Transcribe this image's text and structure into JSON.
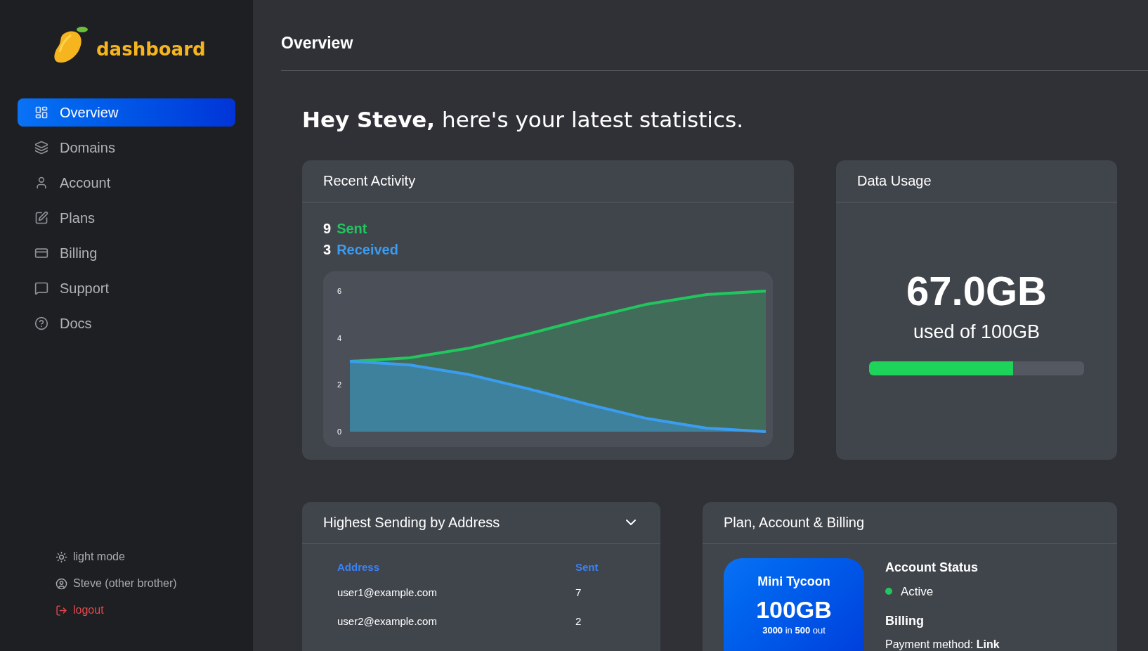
{
  "sidebar": {
    "logo_text": "dashboard",
    "items": [
      {
        "label": "Overview",
        "selected": true
      },
      {
        "label": "Domains",
        "selected": false
      },
      {
        "label": "Account",
        "selected": false
      },
      {
        "label": "Plans",
        "selected": false
      },
      {
        "label": "Billing",
        "selected": false
      },
      {
        "label": "Support",
        "selected": false
      },
      {
        "label": "Docs",
        "selected": false
      }
    ],
    "footer": [
      {
        "label": "light mode",
        "kind": "theme"
      },
      {
        "label": "Steve (other brother)",
        "kind": "user"
      },
      {
        "label": "logout",
        "kind": "logout"
      }
    ]
  },
  "header": {
    "title": "Overview"
  },
  "greeting": "**Hey Steve,** here's your latest statistics.",
  "recent_activity": {
    "title": "Recent Activity",
    "counts": [
      "9",
      "3"
    ],
    "chart_data": {
      "type": "area",
      "categories": [
        null,
        null,
        null,
        null,
        null,
        null,
        null,
        null
      ],
      "ylim": [
        0,
        6.84
      ],
      "yticks": [
        {
          "value": 0,
          "label": "0"
        },
        {
          "value": 2,
          "label": "2"
        },
        {
          "value": 4,
          "label": "4"
        },
        {
          "value": 6,
          "label": "6"
        }
      ],
      "series": [
        {
          "name": "Sent",
          "color": "#22c55e",
          "values": [
            3,
            3.15,
            3.56,
            4.17,
            4.83,
            5.44,
            5.85,
            6
          ]
        },
        {
          "name": "Received",
          "color": "#3b9cf0",
          "values": [
            3,
            2.85,
            2.44,
            1.83,
            1.17,
            0.56,
            0.15,
            0
          ]
        }
      ]
    }
  },
  "data_usage": {
    "title": "Data Usage",
    "amount": "67.0GB",
    "caption": "used of 100GB",
    "level": 0.67
  },
  "highest_sending": {
    "title": "Highest Sending by Address",
    "columns": [
      "Address",
      "Sent"
    ],
    "rows": [
      [
        "user1@example.com",
        "7"
      ],
      [
        "user2@example.com",
        "2"
      ]
    ]
  },
  "plan": {
    "title": "Plan, Account & Billing",
    "plan_name": "Mini Tycoon",
    "plan_size": "100GB",
    "plan_detail": "**3000** in **500** out",
    "account_status": {
      "heading": "Account Status",
      "value": "Active",
      "color": "#22c55e"
    },
    "billing": {
      "heading": "Billing",
      "payment": "Payment method: **Link**"
    }
  }
}
